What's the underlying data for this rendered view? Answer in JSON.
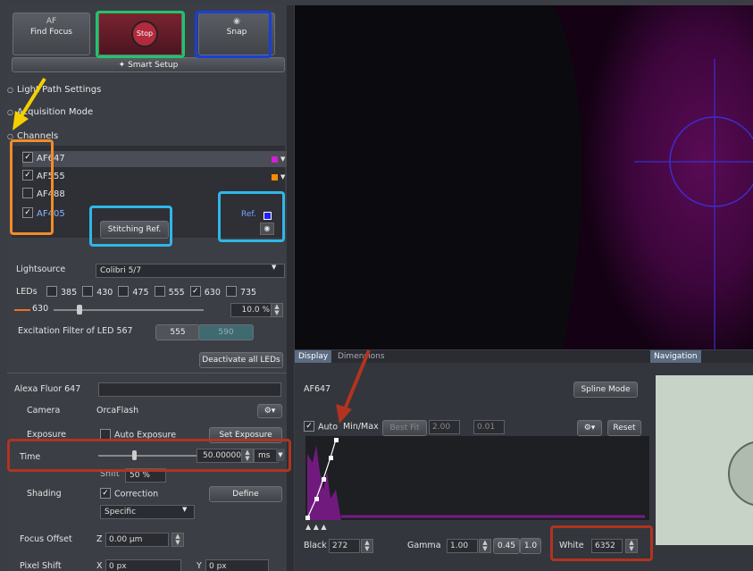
{
  "toolbar": {
    "find_focus_icon": "AF",
    "find_focus": "Find Focus",
    "stop": "Stop",
    "snap": "Snap",
    "smart_setup": "Smart Setup"
  },
  "sections": {
    "light_path": "Light Path Settings",
    "acquisition": "Acquisition Mode",
    "channels": "Channels"
  },
  "channels": [
    {
      "label": "AF647",
      "checked": true,
      "color": "#d020d0"
    },
    {
      "label": "AF555",
      "checked": true,
      "color": "#ff8a00"
    },
    {
      "label": "AF488",
      "checked": false,
      "color": ""
    },
    {
      "label": "AF405",
      "checked": true,
      "color": "#2020ff"
    }
  ],
  "stitching_ref": "Stitching Ref.",
  "ref_label": "Ref.",
  "lightsource": {
    "label": "Lightsource",
    "value": "Colibri 5/7",
    "leds_label": "LEDs",
    "leds": [
      {
        "label": "385",
        "checked": false
      },
      {
        "label": "430",
        "checked": false
      },
      {
        "label": "475",
        "checked": false
      },
      {
        "label": "555",
        "checked": false
      },
      {
        "label": "630",
        "checked": true
      },
      {
        "label": "735",
        "checked": false
      }
    ],
    "slider_label": "630",
    "intensity": "10.0 %",
    "excitation_label": "Excitation Filter of LED 567",
    "filter_a": "555",
    "filter_b": "590",
    "deactivate": "Deactivate all LEDs"
  },
  "dye": {
    "name": "Alexa Fluor 647",
    "camera_label": "Camera",
    "camera_value": "OrcaFlash",
    "exposure_label": "Exposure",
    "auto_exposure": "Auto Exposure",
    "set_exposure": "Set Exposure",
    "time_label": "Time",
    "time_value": "50.00000",
    "time_unit": "ms",
    "shift_label": "Shift",
    "shift_value": "50 %",
    "shading_label": "Shading",
    "correction": "Correction",
    "define": "Define",
    "specific": "Specific",
    "focus_offset_label": "Focus Offset",
    "focus_z": "Z",
    "focus_value": "0.00 µm",
    "pixel_shift_label": "Pixel Shift",
    "px_x": "X",
    "px_x_value": "0 px",
    "px_y": "Y",
    "px_y_value": "0 px"
  },
  "display": {
    "tab_display": "Display",
    "tab_dimensions": "Dimensions",
    "channel": "AF647",
    "spline_mode": "Spline Mode",
    "auto": "Auto",
    "minmax": "Min/Max",
    "bestfit": "Best Fit",
    "v1": "2.00",
    "v2": "0.01",
    "reset": "Reset",
    "black_label": "Black",
    "black": "272",
    "gamma_label": "Gamma",
    "gamma": "1.00",
    "g2": "0.45",
    "g3": "1.0",
    "white_label": "White",
    "white": "6352"
  },
  "navigation": {
    "tab": "Navigation"
  },
  "colors": {
    "green_box": "#22c46a",
    "blue_box": "#1a3fd6",
    "orange_box": "#f28c28",
    "cyan_box": "#2fb7e8",
    "red_box": "#b2331f",
    "yellow_arrow": "#f5d000"
  }
}
